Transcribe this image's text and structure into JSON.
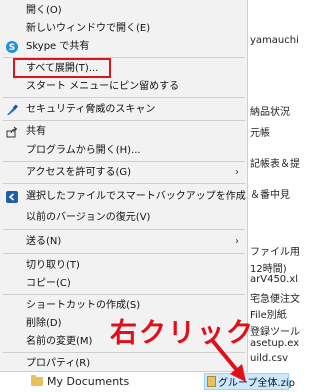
{
  "menu": {
    "items": [
      {
        "label": "開く(O)",
        "icon": "",
        "arrow": false
      },
      {
        "label": "新しいウィンドウで開く(E)",
        "icon": "",
        "arrow": false
      },
      {
        "label": "Skype で共有",
        "icon": "skype-icon",
        "arrow": false
      },
      {
        "label": "すべて展開(T)...",
        "icon": "",
        "arrow": false
      },
      {
        "label": "スタート メニューにピン留めする",
        "icon": "",
        "arrow": false
      },
      {
        "label": "セキュリティ脅威のスキャン",
        "icon": "defender-icon",
        "arrow": false
      },
      {
        "label": "共有",
        "icon": "share-icon",
        "arrow": false
      },
      {
        "label": "プログラムから開く(H)...",
        "icon": "",
        "arrow": false
      },
      {
        "label": "アクセスを許可する(G)",
        "icon": "",
        "arrow": true
      },
      {
        "label": "選択したファイルでスマートバックアップを作成",
        "icon": "backup-icon",
        "arrow": false
      },
      {
        "label": "以前のバージョンの復元(V)",
        "icon": "",
        "arrow": false
      },
      {
        "label": "送る(N)",
        "icon": "",
        "arrow": true
      },
      {
        "label": "切り取り(T)",
        "icon": "",
        "arrow": false
      },
      {
        "label": "コピー(C)",
        "icon": "",
        "arrow": false
      },
      {
        "label": "ショートカットの作成(S)",
        "icon": "",
        "arrow": false
      },
      {
        "label": "削除(D)",
        "icon": "",
        "arrow": false
      },
      {
        "label": "名前の変更(M)",
        "icon": "",
        "arrow": false
      },
      {
        "label": "プロパティ(R)",
        "icon": "",
        "arrow": false
      }
    ]
  },
  "annotation": {
    "text": "右クリック",
    "color": "#e0101a"
  },
  "highlight_color": "#d6181e",
  "background": {
    "fragments": [
      "yamauchi",
      "納品状況",
      "元帳",
      "記帳表＆提",
      "＆番中見",
      "ファイル用",
      "12時間)",
      "arV450.xl",
      "宅急便注文",
      "File別紙",
      "登録ツール",
      "asetup.ex",
      "uild.csv"
    ],
    "selected_file": "グループ全体.zip",
    "folder_label": "My Documents"
  }
}
